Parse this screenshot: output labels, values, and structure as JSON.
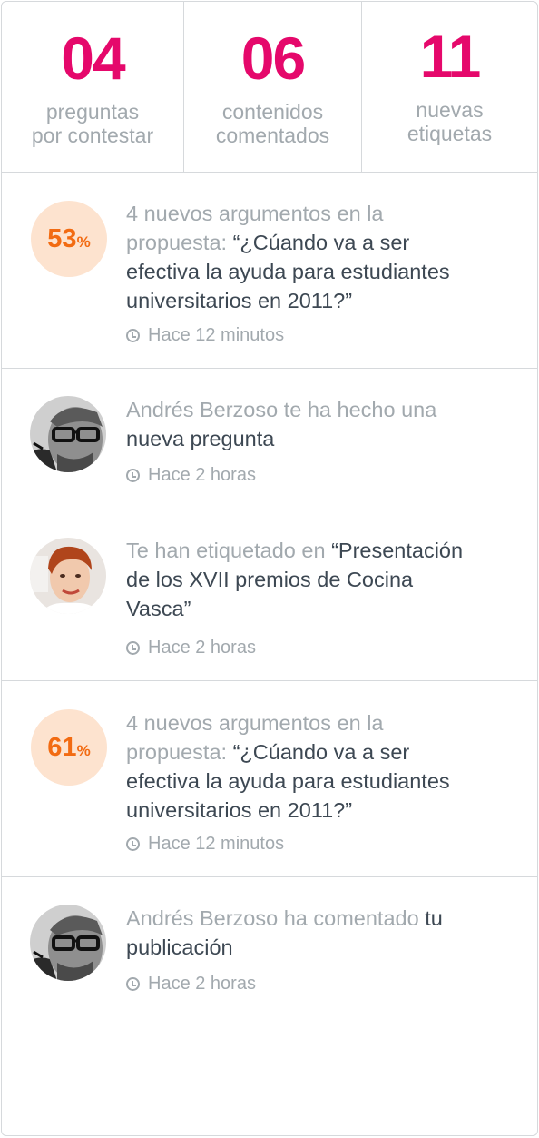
{
  "stats": [
    {
      "number": "04",
      "line1": "preguntas",
      "line2": "por contestar"
    },
    {
      "number": "06",
      "line1": "contenidos",
      "line2": "comentados"
    },
    {
      "number": "11",
      "line1": "nuevas",
      "line2": "etiquetas"
    }
  ],
  "feed": [
    {
      "type": "percent",
      "percent": "53",
      "percent_symbol": "%",
      "line1": "4 nuevos argumentos en la",
      "line2_gray": "propuesta: ",
      "line2_dark": "“¿Cúando va a ser",
      "line3": "efectiva la ayuda para estudiantes",
      "line4": "universitarios en 2011?”",
      "time": "Hace 12 minutos"
    },
    {
      "type": "avatar",
      "avatar": "man-with-glasses",
      "line1": "Andrés Berzoso te ha hecho una",
      "line2": "nueva pregunta",
      "time": "Hace 2 horas"
    },
    {
      "type": "avatar",
      "avatar": "woman-short-hair",
      "line1_gray": "Te han etiquetado en ",
      "line1_dark": "“Presentación",
      "line2": "de los XVII premios de Cocina",
      "line3": "Vasca”",
      "time": "Hace 2 horas"
    },
    {
      "type": "percent",
      "percent": "61",
      "percent_symbol": "%",
      "line1": "4 nuevos argumentos en la",
      "line2_gray": "propuesta: ",
      "line2_dark": "“¿Cúando va a ser",
      "line3": "efectiva la ayuda para estudiantes",
      "line4": "universitarios en 2011?”",
      "time": "Hace 12 minutos"
    },
    {
      "type": "avatar",
      "avatar": "man-with-glasses",
      "line1_gray": "Andrés Berzoso ha comentado ",
      "line1_dark": "tu",
      "line2": "publicación",
      "time": "Hace 2 horas"
    }
  ],
  "colors": {
    "accent_pink": "#e5086b",
    "percent_orange": "#f26b12",
    "badge_bg": "#fde3cf",
    "muted_text": "#a2a9ae",
    "dark_text": "#3d4853",
    "divider": "#d6d9dc"
  }
}
